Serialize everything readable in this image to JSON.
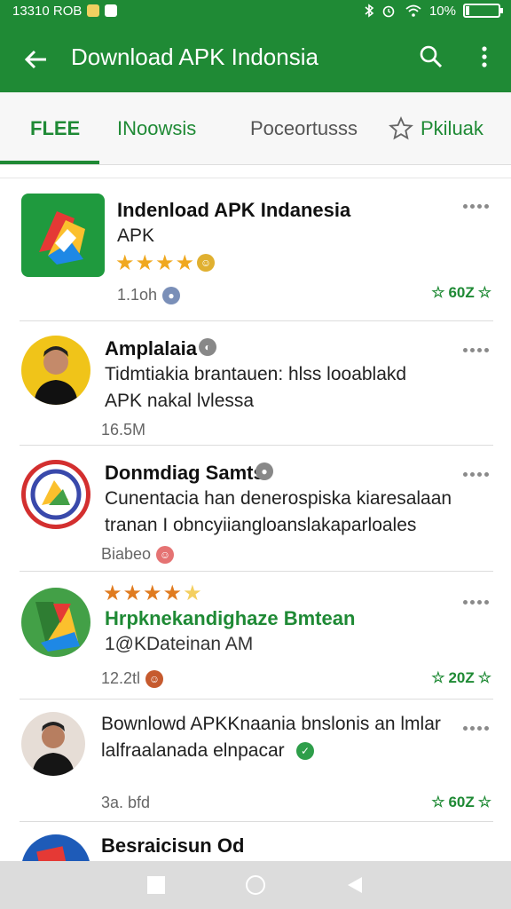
{
  "status": {
    "time": "13310 ROB",
    "battery": "10%",
    "battery_fraction": 0.1
  },
  "appbar": {
    "title": "Download APK Indonsia"
  },
  "tabs": [
    {
      "label": "FLEE"
    },
    {
      "label": "INoowsis"
    },
    {
      "label": "Poceortusss"
    },
    {
      "label": "Pkiluak"
    }
  ],
  "items": [
    {
      "name": "Indenload APK Indanesia",
      "subtitle": "APK",
      "rating": "★★★★",
      "meta": "1.1oh",
      "likes": "60Z"
    },
    {
      "name": "Amplalaia",
      "desc1": "Tidmtiakia brantauen: hlss looablakd",
      "desc2": "APK nakal lvlessa",
      "meta": "16.5M"
    },
    {
      "name": "Donmdiag Samts",
      "desc1": "Cunentacia han denerospiska kiaresalaan",
      "desc2": "tranan I obncyiiangloanslakaparloales",
      "meta": "Biabeo"
    },
    {
      "rating": "★★★★",
      "rating_half": "★",
      "name": "Hrpknekandighaze Bmtean",
      "subtitle": "1@KDateinan AM",
      "meta": "12.2tl",
      "likes": "20Z"
    },
    {
      "name": "Bownlowd APKKnaania bnslonis an lmlar",
      "desc1": "lalfraalanada elnpacar",
      "meta": "3a. bfd",
      "likes": "60Z"
    },
    {
      "name": "Besraicisun Od"
    }
  ]
}
